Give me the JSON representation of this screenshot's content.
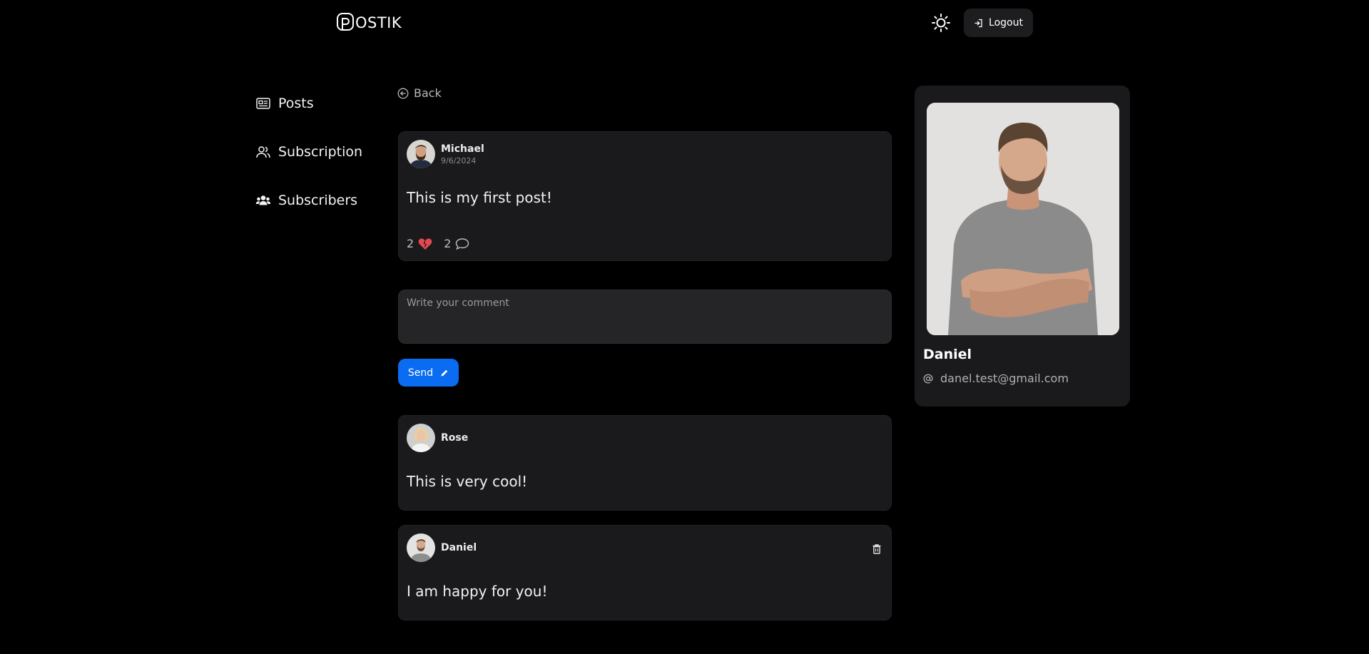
{
  "header": {
    "logo_letter": "P",
    "logo_text": "OSTIK",
    "logout_label": "Logout"
  },
  "sidebar": {
    "items": [
      {
        "label": "Posts",
        "icon": "newspaper-icon"
      },
      {
        "label": "Subscription",
        "icon": "users-outline-icon"
      },
      {
        "label": "Subscribers",
        "icon": "users-solid-icon"
      }
    ]
  },
  "main": {
    "back_label": "Back",
    "post": {
      "author": "Michael",
      "date": "9/6/2024",
      "text": "This is my first post!",
      "likes": "2",
      "comments": "2"
    },
    "comment_input": {
      "placeholder": "Write your comment",
      "value": ""
    },
    "send_label": "Send",
    "comments": [
      {
        "author": "Rose",
        "text": "This is very cool!"
      },
      {
        "author": "Daniel",
        "text": "I am happy for you!"
      }
    ]
  },
  "profile": {
    "name": "Daniel",
    "email": "danel.test@gmail.com"
  },
  "colors": {
    "background": "#000000",
    "card": "#1a1a1d",
    "accent": "#0a6cf0",
    "like": "#e5484d"
  }
}
